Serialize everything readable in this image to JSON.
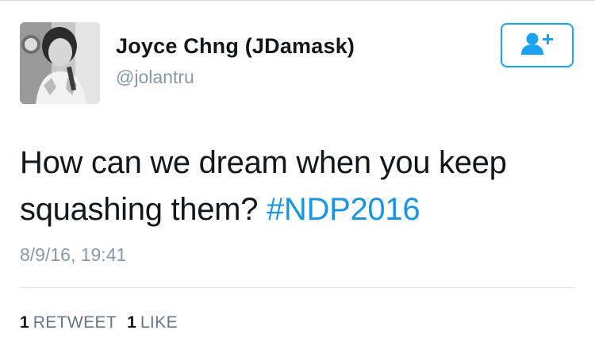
{
  "user": {
    "display_name": "Joyce Chng (JDamask)",
    "handle": "@jolantru",
    "avatar": "user-avatar-photo"
  },
  "follow_button": {
    "icon": "add-user-icon",
    "color": "#1da1f2"
  },
  "tweet": {
    "text": "How can we dream when you keep squashing them?",
    "hashtag": "#NDP2016",
    "timestamp": "8/9/16, 19:41"
  },
  "stats": {
    "retweets": {
      "count": "1",
      "label": "RETWEET"
    },
    "likes": {
      "count": "1",
      "label": "LIKE"
    }
  },
  "colors": {
    "text": "#14171a",
    "secondary": "#8899a6",
    "link": "#1b95e0",
    "divider": "#e1e8ed"
  }
}
